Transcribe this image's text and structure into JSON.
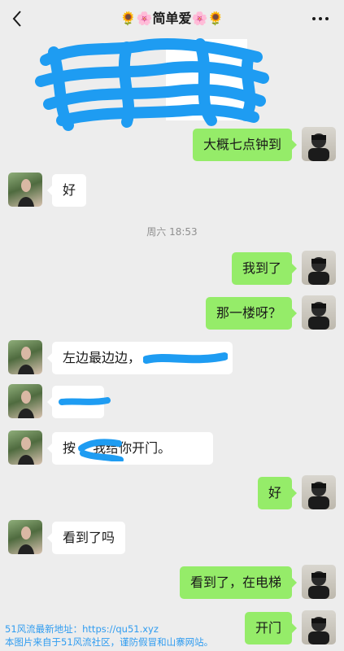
{
  "header": {
    "title": "🌻🌸简单爱🌸🌻"
  },
  "timestamp": "周六 18:53",
  "messages": [
    {
      "side": "out",
      "text": "大概七点钟到"
    },
    {
      "side": "in",
      "text": "好"
    },
    {
      "side": "out",
      "text": "我到了"
    },
    {
      "side": "out",
      "text": "那一楼呀？"
    },
    {
      "side": "in",
      "text": "左边最边边，"
    },
    {
      "side": "in",
      "text": ""
    },
    {
      "side": "in",
      "text": "按 ，我给你开门。"
    },
    {
      "side": "out",
      "text": "好"
    },
    {
      "side": "in",
      "text": "看到了吗"
    },
    {
      "side": "out",
      "text": "看到了，在电梯"
    },
    {
      "side": "out",
      "text": "开门"
    }
  ],
  "watermark": {
    "line1": "51风流最新地址：https://qu51.xyz",
    "line2": "本图片来自于51风流社区，谨防假冒和山寨网站。"
  },
  "colors": {
    "background": "#ededed",
    "outgoing_bubble": "#95ec69",
    "incoming_bubble": "#ffffff",
    "redaction": "#1e9cf2",
    "watermark": "#2f9cf0"
  },
  "icons": {
    "back": "chevron-left-icon",
    "more": "more-dots-icon"
  }
}
